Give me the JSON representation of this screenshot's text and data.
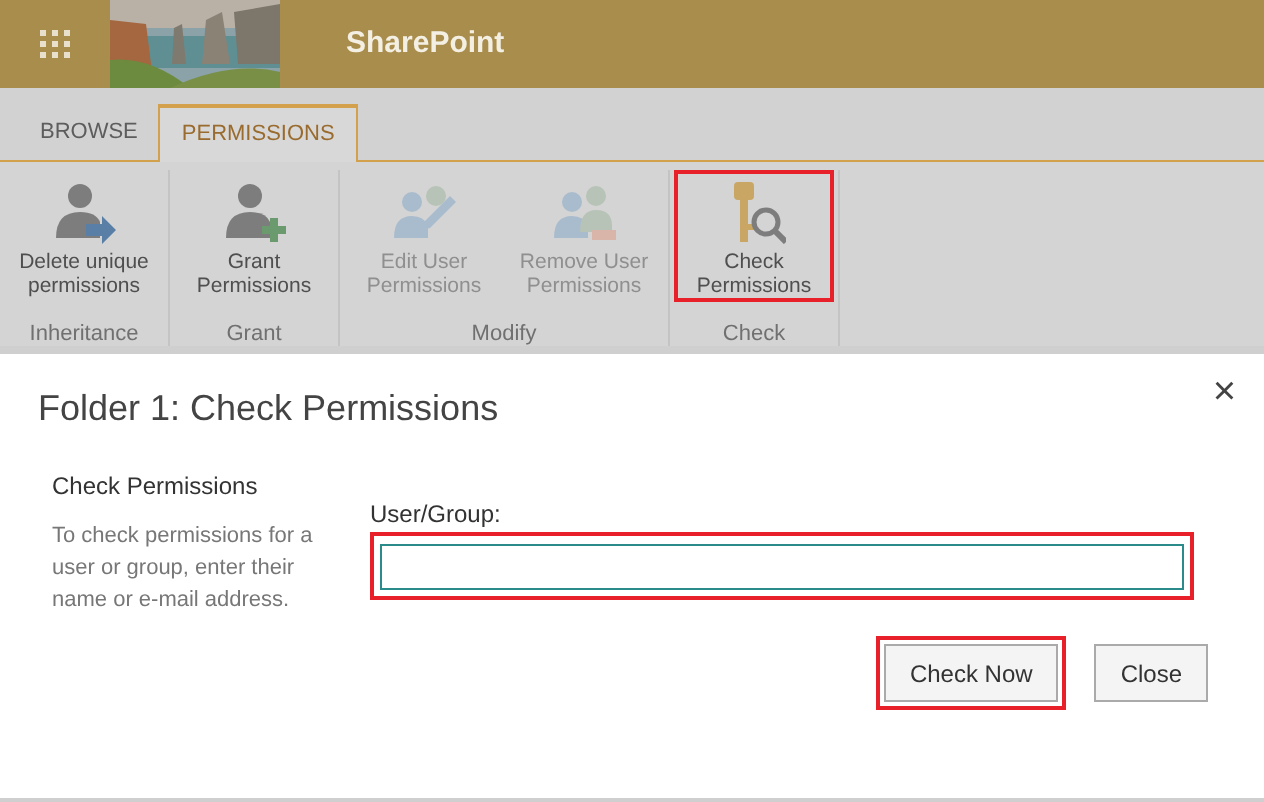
{
  "header": {
    "app_title": "SharePoint"
  },
  "tabs": [
    {
      "label": "BROWSE",
      "selected": false
    },
    {
      "label": "PERMISSIONS",
      "selected": true
    }
  ],
  "ribbon_groups": [
    {
      "label": "Inheritance",
      "buttons": [
        {
          "label": "Delete unique permissions",
          "kind": "delete",
          "disabled": false,
          "highlighted": false
        }
      ]
    },
    {
      "label": "Grant",
      "buttons": [
        {
          "label": "Grant Permissions",
          "kind": "grant",
          "disabled": false,
          "highlighted": false
        }
      ]
    },
    {
      "label": "Modify",
      "buttons": [
        {
          "label": "Edit User Permissions",
          "kind": "edit",
          "disabled": true,
          "highlighted": false
        },
        {
          "label": "Remove User Permissions",
          "kind": "remove",
          "disabled": true,
          "highlighted": false
        }
      ]
    },
    {
      "label": "Check",
      "buttons": [
        {
          "label": "Check Permissions",
          "kind": "check",
          "disabled": false,
          "highlighted": true
        }
      ]
    }
  ],
  "dialog": {
    "title": "Folder 1: Check Permissions",
    "close": "×",
    "section_title": "Check Permissions",
    "description": "To check permissions for a user or group, enter their name or e-mail address.",
    "field": {
      "label": "User/Group:",
      "highlighted": true
    },
    "buttons": [
      {
        "label": "Check Now",
        "highlighted": true
      },
      {
        "label": "Close",
        "highlighted": false
      }
    ]
  }
}
